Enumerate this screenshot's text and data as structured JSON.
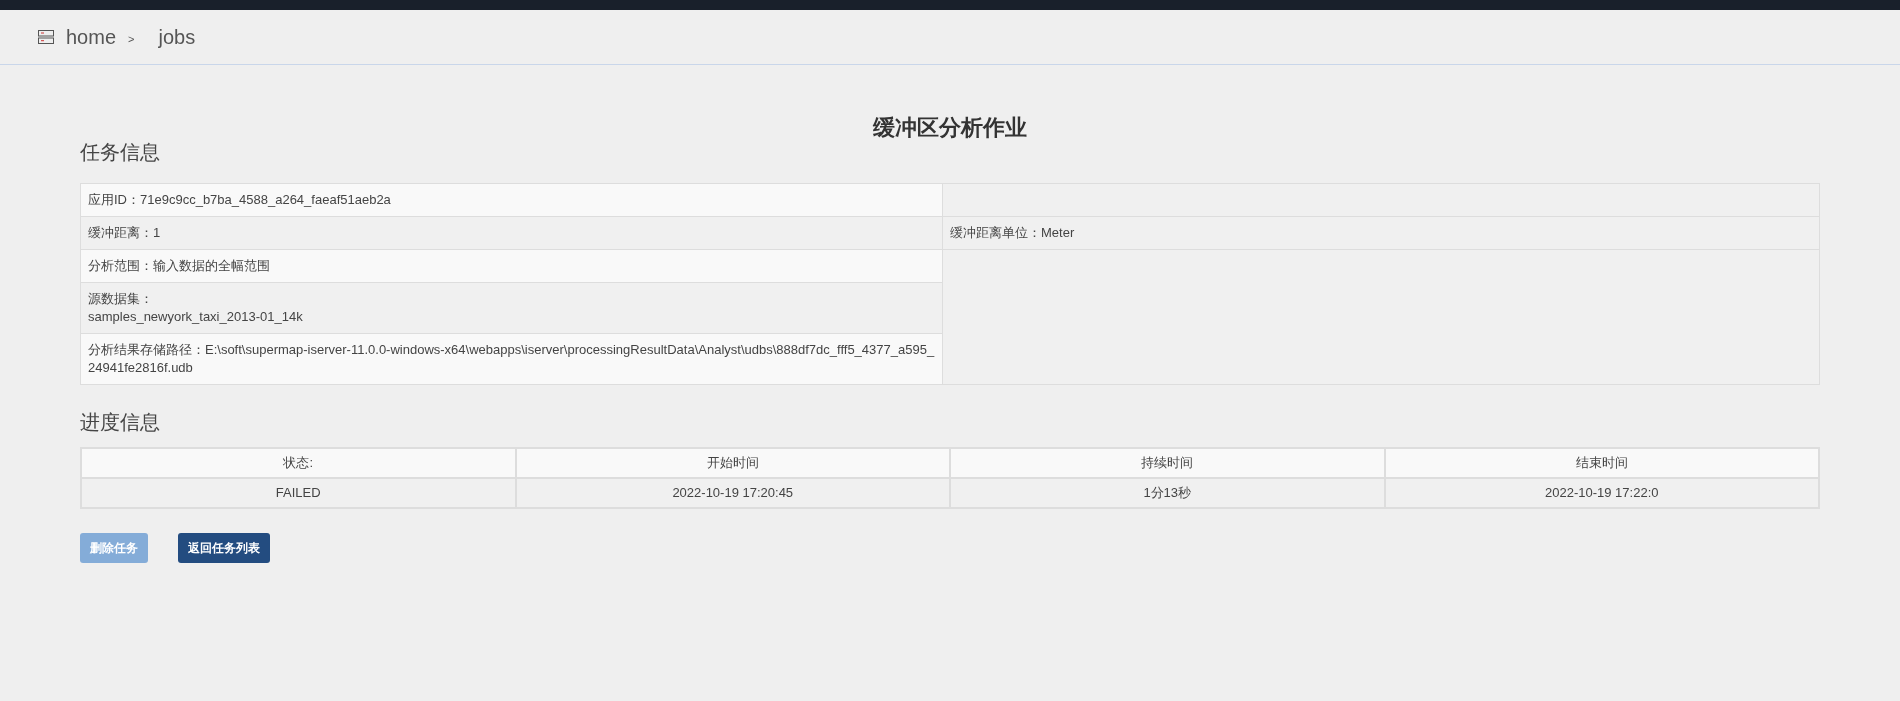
{
  "breadcrumb": {
    "items": [
      {
        "label": "home"
      },
      {
        "label": "jobs"
      }
    ],
    "separator": ">"
  },
  "title": "缓冲区分析作业",
  "task_info": {
    "heading": "任务信息",
    "rows": [
      {
        "left": [
          "应用ID：71e9c9cc_b7ba_4588_a264_faeaf51aeb2a"
        ],
        "right": ""
      },
      {
        "left": [
          "缓冲距离：1"
        ],
        "right": "缓冲距离单位：Meter"
      },
      {
        "left": [
          "分析范围：输入数据的全幅范围"
        ]
      },
      {
        "left": [
          "源数据集：",
          "samples_newyork_taxi_2013-01_14k"
        ]
      },
      {
        "left": [
          "分析结果存储路径：E:\\soft\\supermap-iserver-11.0.0-windows-x64\\webapps\\iserver\\processingResultData\\Analyst\\udbs\\888df7dc_fff5_4377_a595_24941fe2816f.udb"
        ]
      }
    ]
  },
  "progress_info": {
    "heading": "进度信息",
    "columns": [
      "状态:",
      "开始时间",
      "持续时间",
      "结束时间"
    ],
    "row": [
      "FAILED",
      "2022-10-19 17:20:45",
      "1分13秒",
      "2022-10-19 17:22:0"
    ]
  },
  "buttons": [
    {
      "label": "删除任务",
      "disabled": true
    },
    {
      "label": "返回任务列表",
      "disabled": false
    }
  ]
}
